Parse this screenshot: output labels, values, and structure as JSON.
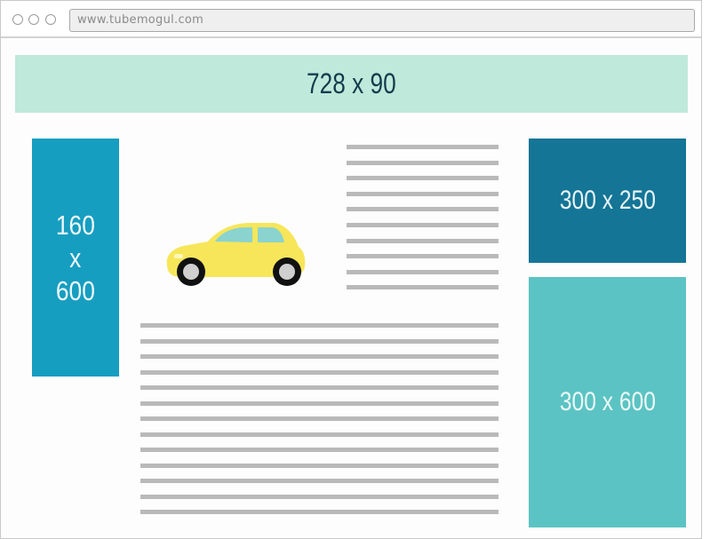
{
  "browser": {
    "address": "www.tubemogul.com"
  },
  "ads": {
    "leaderboard": "728 x 90",
    "skyscraper": [
      "160",
      "x",
      "600"
    ],
    "medium_rectangle": "300 x 250",
    "half_page": "300 x 600"
  },
  "icons": {
    "car": "car-illustration"
  },
  "colors": {
    "leaderboard": "#bfe9da",
    "skyscraper": "#169ec0",
    "medium_rectangle": "#147596",
    "half_page": "#5bc3c3",
    "text_placeholder": "#b9b9b9",
    "car_body": "#f7e65a"
  }
}
